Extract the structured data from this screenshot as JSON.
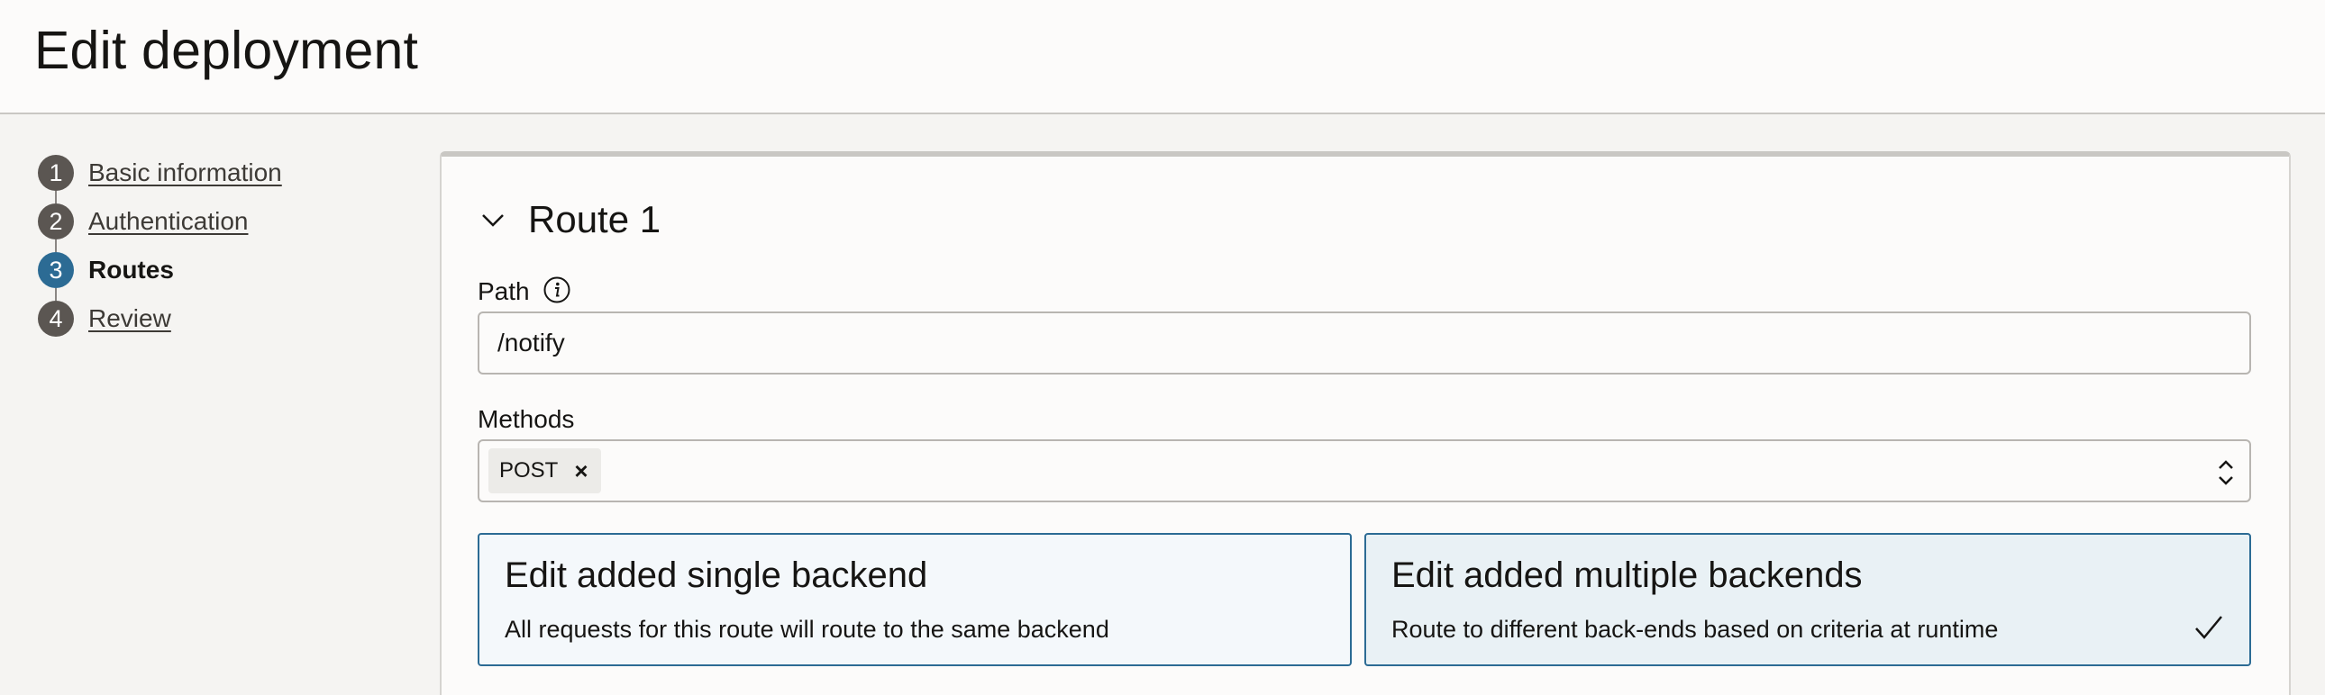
{
  "header": {
    "title": "Edit deployment"
  },
  "steps": [
    {
      "number": "1",
      "label": "Basic information",
      "state": "link"
    },
    {
      "number": "2",
      "label": "Authentication",
      "state": "link"
    },
    {
      "number": "3",
      "label": "Routes",
      "state": "current"
    },
    {
      "number": "4",
      "label": "Review",
      "state": "link"
    }
  ],
  "route": {
    "title": "Route 1",
    "path": {
      "label": "Path",
      "value": "/notify"
    },
    "methods": {
      "label": "Methods",
      "selected": [
        "POST"
      ]
    },
    "options": [
      {
        "title": "Edit added single backend",
        "description": "All requests for this route will route to the same backend",
        "selected": false
      },
      {
        "title": "Edit added multiple backends",
        "description": "Route to different back-ends based on criteria at runtime",
        "selected": true
      }
    ]
  },
  "colors": {
    "accent": "#2c6b94",
    "step_inactive": "#5b5652",
    "selected_card_bg": "#e9f1f5"
  },
  "icons": [
    "chevron-down-icon",
    "info-icon",
    "close-icon",
    "select-arrows-icon",
    "checkmark-icon"
  ]
}
